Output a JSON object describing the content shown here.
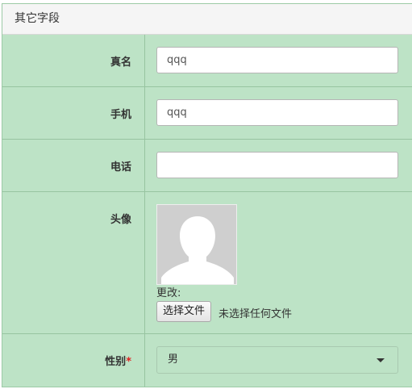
{
  "panel": {
    "title": "其它字段"
  },
  "fields": {
    "real_name": {
      "label": "真名",
      "value": "qqq"
    },
    "mobile": {
      "label": "手机",
      "value": "qqq"
    },
    "phone": {
      "label": "电话",
      "value": ""
    },
    "avatar": {
      "label": "头像",
      "change_label": "更改:",
      "file_button": "选择文件",
      "file_status": "未选择任何文件"
    },
    "gender": {
      "label": "性别",
      "required_mark": "*",
      "selected": "男"
    }
  },
  "icons": {
    "avatar_placeholder": "default-user-avatar",
    "select_arrow": "caret-down"
  }
}
